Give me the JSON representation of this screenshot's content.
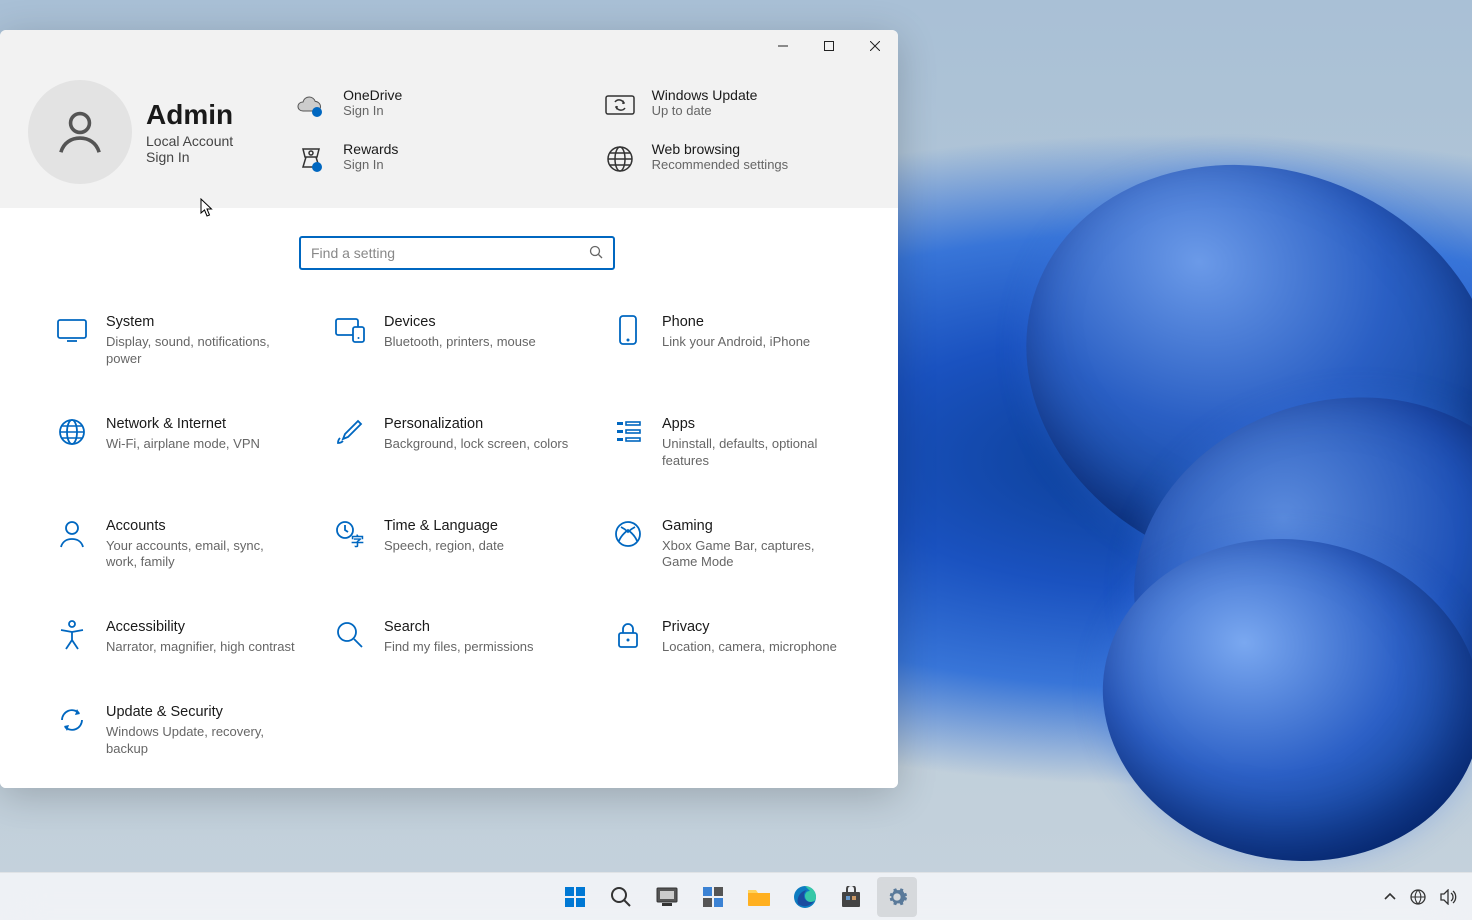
{
  "user": {
    "name": "Admin",
    "account_type": "Local Account",
    "sign_in": "Sign In"
  },
  "header_tiles": {
    "onedrive": {
      "title": "OneDrive",
      "sub": "Sign In"
    },
    "rewards": {
      "title": "Rewards",
      "sub": "Sign In"
    },
    "update": {
      "title": "Windows Update",
      "sub": "Up to date"
    },
    "browsing": {
      "title": "Web browsing",
      "sub": "Recommended settings"
    }
  },
  "search": {
    "placeholder": "Find a setting"
  },
  "categories": [
    {
      "id": "system",
      "title": "System",
      "sub": "Display, sound, notifications, power"
    },
    {
      "id": "devices",
      "title": "Devices",
      "sub": "Bluetooth, printers, mouse"
    },
    {
      "id": "phone",
      "title": "Phone",
      "sub": "Link your Android, iPhone"
    },
    {
      "id": "network",
      "title": "Network & Internet",
      "sub": "Wi-Fi, airplane mode, VPN"
    },
    {
      "id": "personalization",
      "title": "Personalization",
      "sub": "Background, lock screen, colors"
    },
    {
      "id": "apps",
      "title": "Apps",
      "sub": "Uninstall, defaults, optional features"
    },
    {
      "id": "accounts",
      "title": "Accounts",
      "sub": "Your accounts, email, sync, work, family"
    },
    {
      "id": "time",
      "title": "Time & Language",
      "sub": "Speech, region, date"
    },
    {
      "id": "gaming",
      "title": "Gaming",
      "sub": "Xbox Game Bar, captures, Game Mode"
    },
    {
      "id": "accessibility",
      "title": "Accessibility",
      "sub": "Narrator, magnifier, high contrast"
    },
    {
      "id": "search",
      "title": "Search",
      "sub": "Find my files, permissions"
    },
    {
      "id": "privacy",
      "title": "Privacy",
      "sub": "Location, camera, microphone"
    },
    {
      "id": "update",
      "title": "Update & Security",
      "sub": "Windows Update, recovery, backup"
    }
  ],
  "taskbar": {
    "items": [
      "start",
      "search",
      "task-view",
      "widgets",
      "explorer",
      "edge",
      "store",
      "settings"
    ]
  }
}
